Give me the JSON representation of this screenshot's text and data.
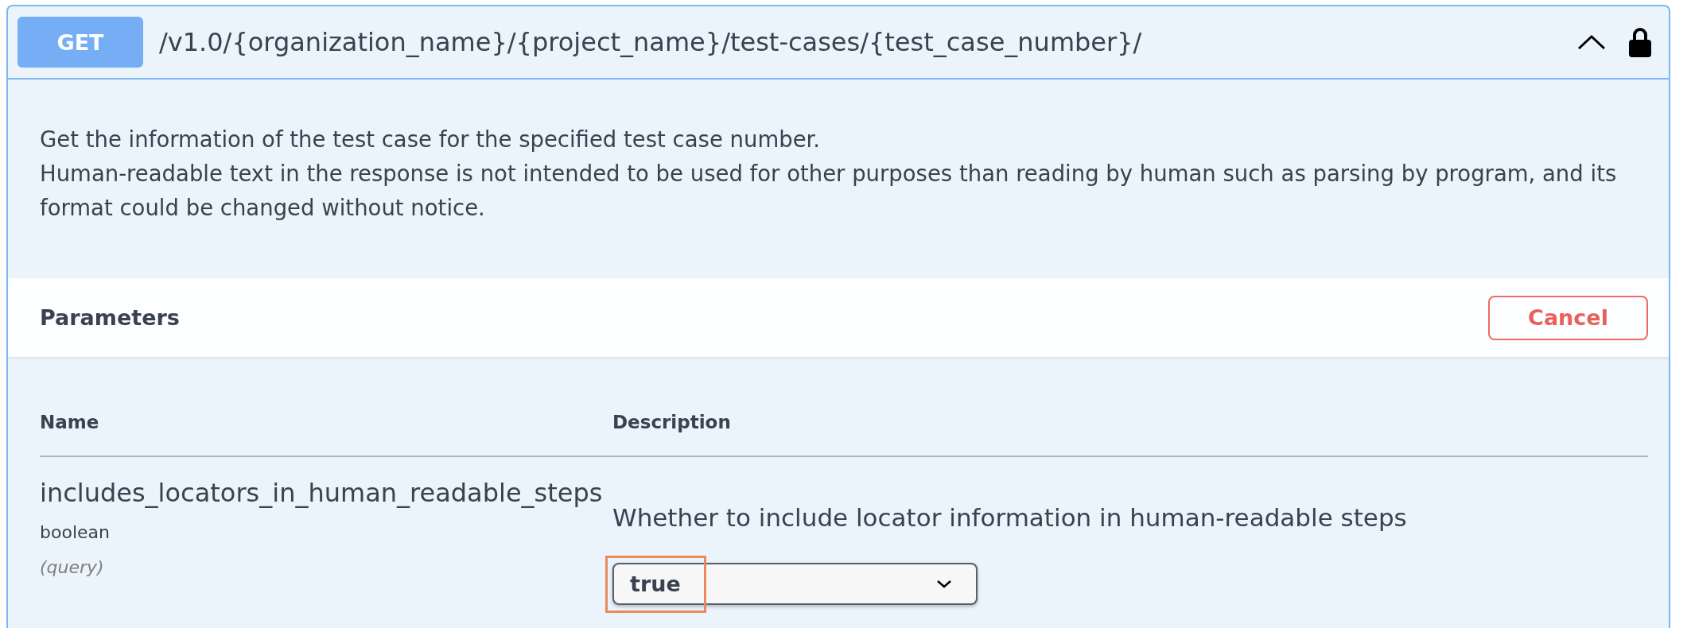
{
  "operation": {
    "method": "GET",
    "path": "/v1.0/{organization_name}/{project_name}/test-cases/{test_case_number}/",
    "expanded": true,
    "locked": true
  },
  "description": [
    "Get the information of the test case for the specified test case number.",
    "Human-readable text in the response is not intended to be used for other purposes than reading by human such as parsing by program, and its format could be changed without notice."
  ],
  "parameters": {
    "title": "Parameters",
    "cancel_button": "Cancel",
    "columns": [
      "Name",
      "Description"
    ],
    "rows": [
      {
        "name": "includes_locators_in_human_readable_steps",
        "type": "boolean",
        "location": "(query)",
        "description": "Whether to include locator information in human-readable steps",
        "value": "true",
        "highlighted": true
      }
    ]
  }
}
